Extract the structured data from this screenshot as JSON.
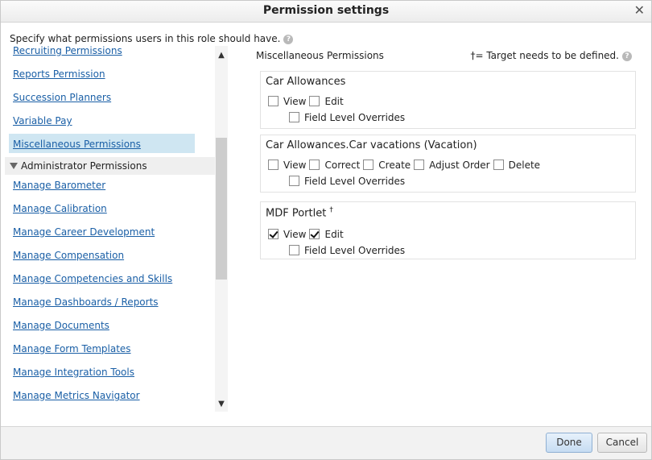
{
  "dialog": {
    "title": "Permission settings",
    "close_glyph": "✕",
    "intro": "Specify what permissions users in this role should have.",
    "help_glyph": "?"
  },
  "nav": {
    "items_before": [
      {
        "label": "Recruiting Permissions"
      },
      {
        "label": "Reports Permission"
      },
      {
        "label": "Succession Planners"
      },
      {
        "label": "Variable Pay"
      },
      {
        "label": "Miscellaneous Permissions",
        "selected": true
      }
    ],
    "group_header": "Administrator Permissions",
    "items_after": [
      {
        "label": "Manage Barometer"
      },
      {
        "label": "Manage Calibration"
      },
      {
        "label": "Manage Career Development"
      },
      {
        "label": "Manage Compensation"
      },
      {
        "label": "Manage Competencies and Skills"
      },
      {
        "label": "Manage Dashboards / Reports"
      },
      {
        "label": "Manage Documents"
      },
      {
        "label": "Manage Form Templates"
      },
      {
        "label": "Manage Integration Tools"
      },
      {
        "label": "Manage Metrics Navigator"
      }
    ],
    "scroll_up_glyph": "▲",
    "scroll_down_glyph": "▼"
  },
  "content": {
    "section_title": "Miscellaneous Permissions",
    "target_note": "†= Target needs to be defined.",
    "cards": [
      {
        "title": "Car Allowances",
        "mark": "",
        "options": [
          {
            "label": "View",
            "checked": false
          },
          {
            "label": "Edit",
            "checked": false
          }
        ],
        "override": {
          "label": "Field Level Overrides",
          "checked": false
        }
      },
      {
        "title": "Car Allowances.Car vacations (Vacation)",
        "mark": "",
        "options": [
          {
            "label": "View",
            "checked": false
          },
          {
            "label": "Correct",
            "checked": false
          },
          {
            "label": "Create",
            "checked": false
          },
          {
            "label": "Adjust Order",
            "checked": false
          },
          {
            "label": "Delete",
            "checked": false
          }
        ],
        "override": {
          "label": "Field Level Overrides",
          "checked": false
        }
      },
      {
        "title": "MDF Portlet",
        "mark": "†",
        "options": [
          {
            "label": "View",
            "checked": true
          },
          {
            "label": "Edit",
            "checked": true
          }
        ],
        "override": {
          "label": "Field Level Overrides",
          "checked": false
        }
      }
    ]
  },
  "footer": {
    "done_label": "Done",
    "cancel_label": "Cancel"
  }
}
